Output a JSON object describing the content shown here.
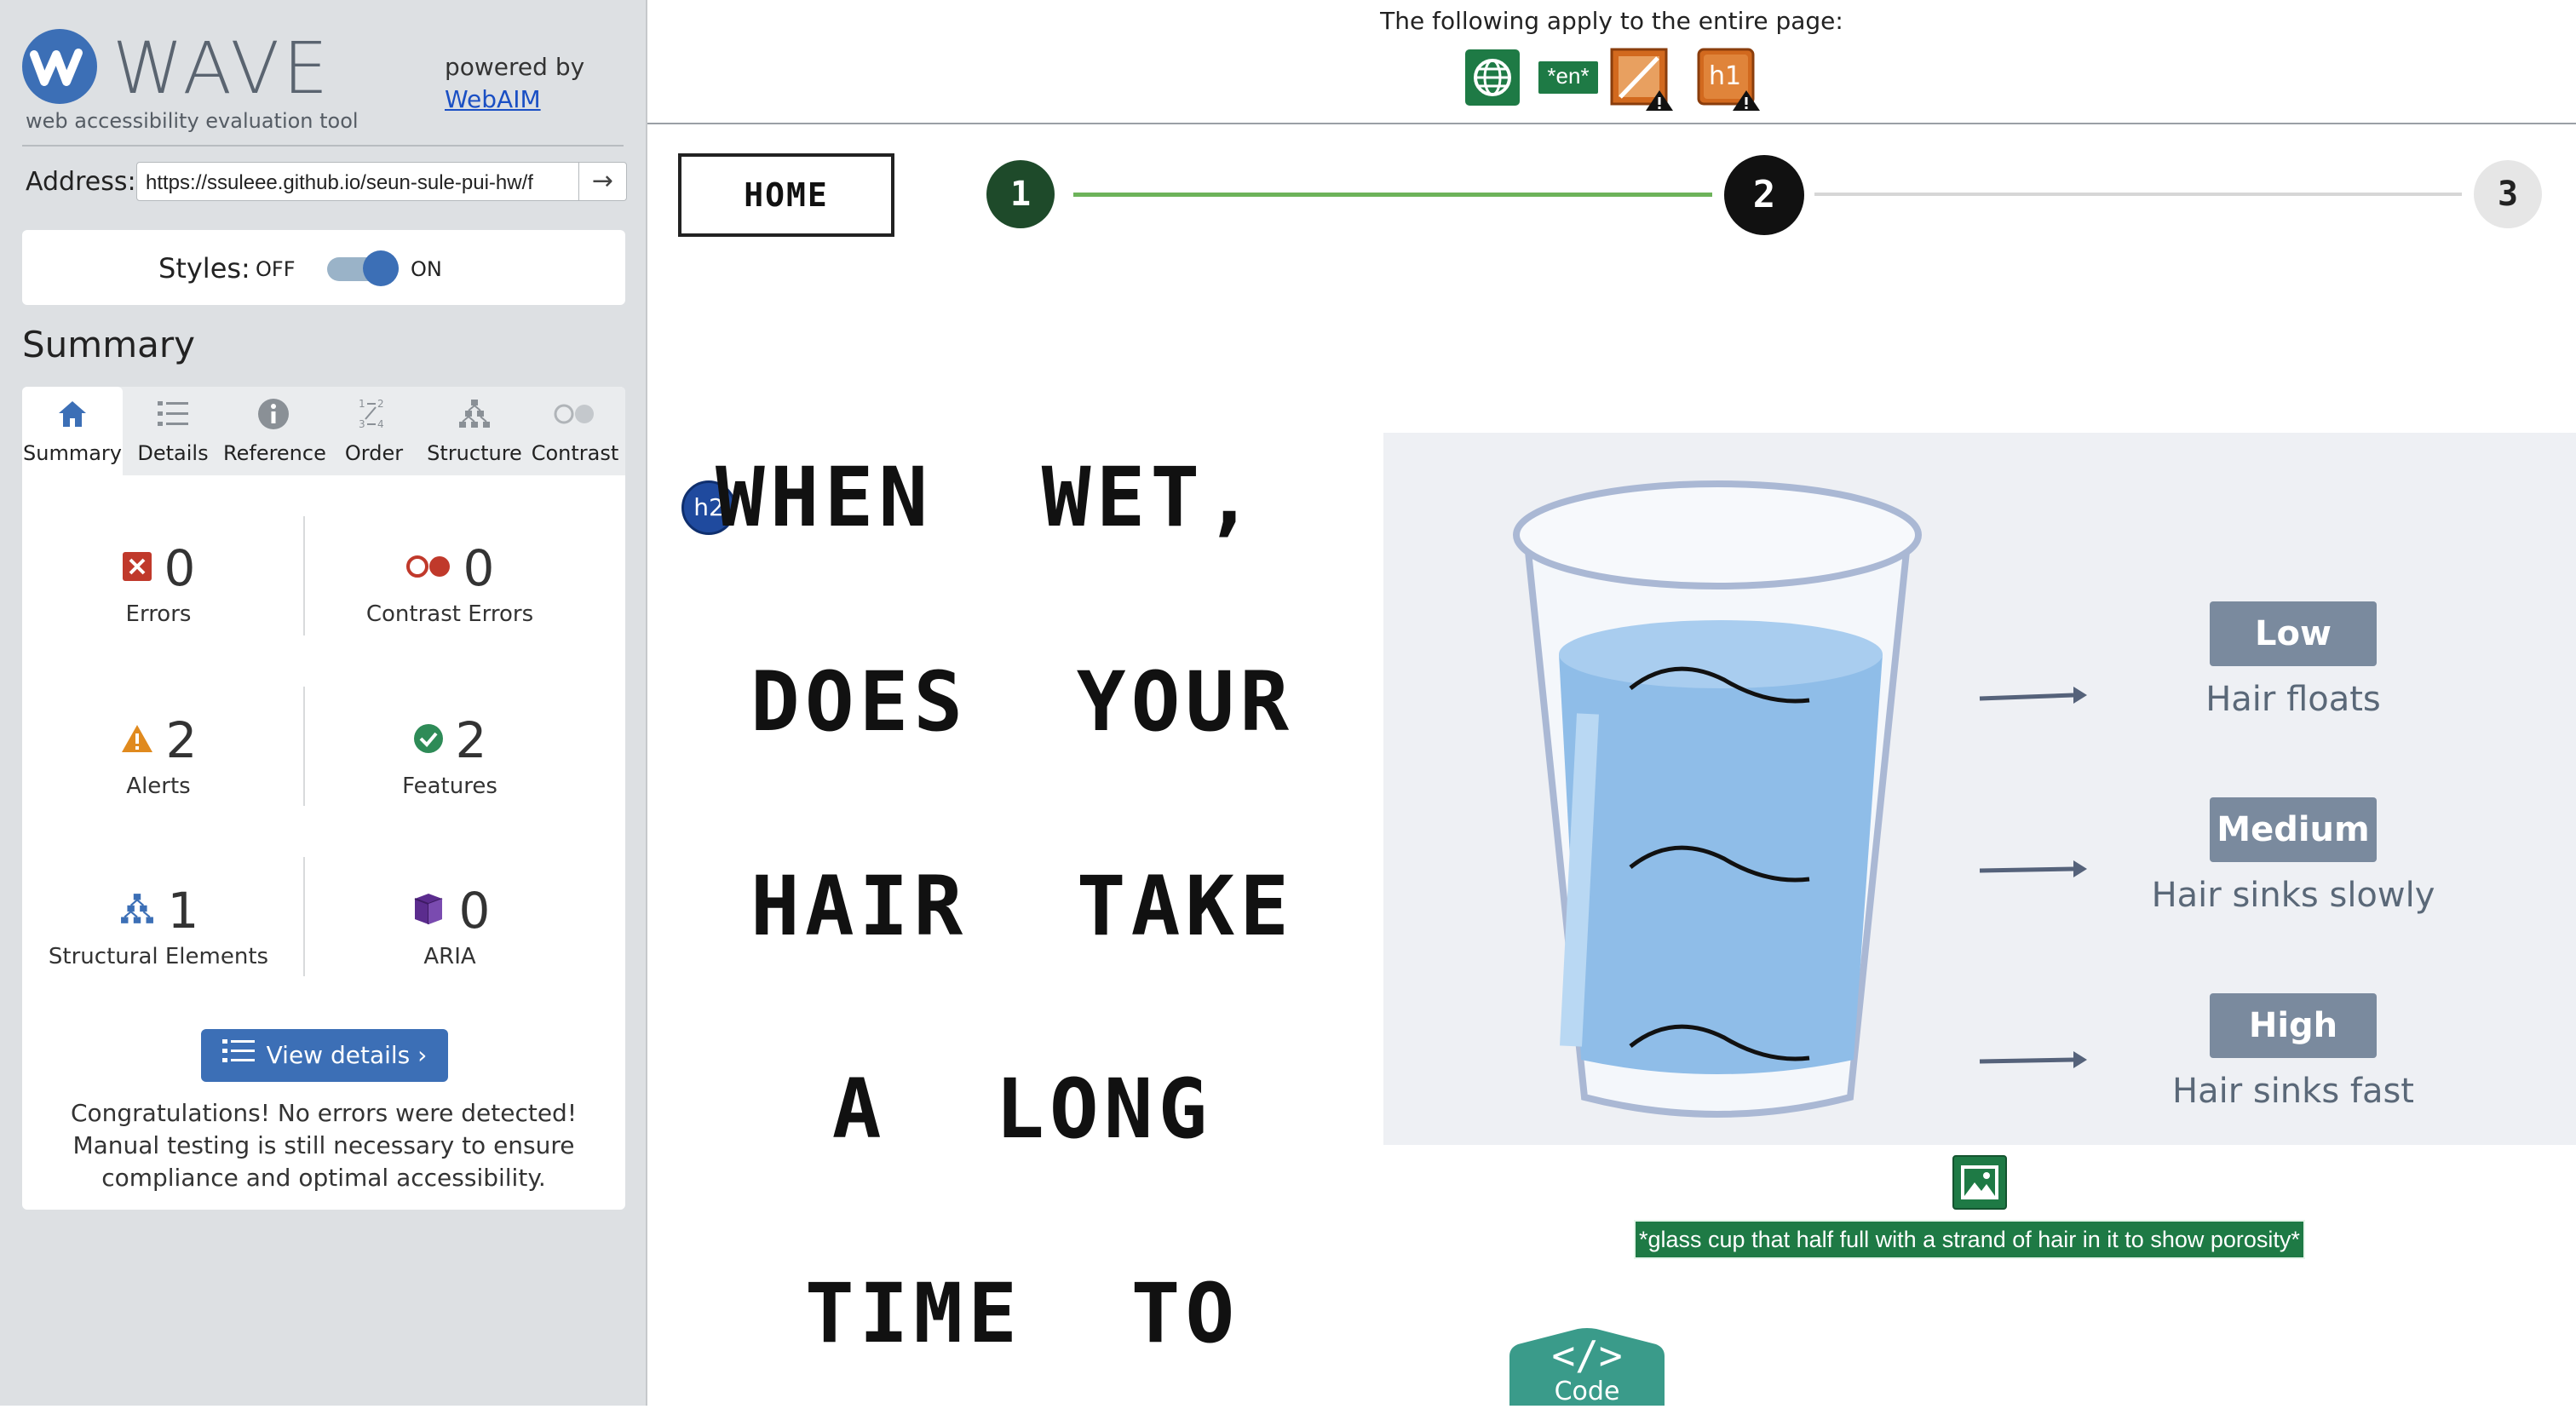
{
  "wave": {
    "brand": "WAVE",
    "subtitle": "web accessibility evaluation tool",
    "powered_by": "powered by",
    "powered_link": "WebAIM",
    "address_label": "Address:",
    "address_value": "https://ssuleee.github.io/seun-sule-pui-hw/f",
    "styles_label": "Styles:",
    "styles_off": "OFF",
    "styles_on": "ON",
    "styles_enabled": true,
    "summary_heading": "Summary",
    "tabs": [
      {
        "label": "Summary",
        "icon": "home-icon",
        "active": true
      },
      {
        "label": "Details",
        "icon": "list-icon",
        "active": false
      },
      {
        "label": "Reference",
        "icon": "info-icon",
        "active": false
      },
      {
        "label": "Order",
        "icon": "order-icon",
        "active": false
      },
      {
        "label": "Structure",
        "icon": "structure-icon",
        "active": false
      },
      {
        "label": "Contrast",
        "icon": "contrast-icon",
        "active": false
      }
    ],
    "stats": {
      "errors": {
        "count": "0",
        "label": "Errors",
        "color": "#c0392b"
      },
      "contrast_errors": {
        "count": "0",
        "label": "Contrast Errors",
        "color": "#c0392b"
      },
      "alerts": {
        "count": "2",
        "label": "Alerts",
        "color": "#e08a1e"
      },
      "features": {
        "count": "2",
        "label": "Features",
        "color": "#2e8b57"
      },
      "structural": {
        "count": "1",
        "label": "Structural Elements",
        "color": "#3c6fb6"
      },
      "aria": {
        "count": "0",
        "label": "ARIA",
        "color": "#5b2c8e"
      }
    },
    "view_details": "View details ›",
    "congrats": "Congratulations! No errors were detected! Manual testing is still necessary to ensure compliance and optimal accessibility."
  },
  "topbar": {
    "text": "The following apply to the entire page:",
    "icons": [
      "language-globe-icon",
      "lang-en-icon",
      "no-heading-structure-alert-icon",
      "missing-first-level-heading-alert-icon"
    ],
    "lang_badge": "*en*",
    "h1_badge": "h1"
  },
  "page": {
    "home_label": "HOME",
    "steps": [
      "1",
      "2",
      "3"
    ],
    "current_step": 2,
    "h2_badge": "h2",
    "heading_lines": [
      "WHEN  WET,",
      "DOES  YOUR",
      "HAIR  TAKE",
      "A  LONG",
      "TIME  TO"
    ],
    "porosity": [
      {
        "level": "Low",
        "desc": "Hair floats"
      },
      {
        "level": "Medium",
        "desc": "Hair sinks slowly"
      },
      {
        "level": "High",
        "desc": "Hair sinks fast"
      }
    ],
    "alt_text": "*glass cup that half full with a strand of hair in it to show porosity*",
    "code_label": "Code",
    "code_symbol": "</>"
  },
  "colors": {
    "wave_blue": "#3c6fb6",
    "feature_green": "#1e7a45",
    "step_done": "#1e4a2a",
    "progress_green": "#6db35a"
  }
}
